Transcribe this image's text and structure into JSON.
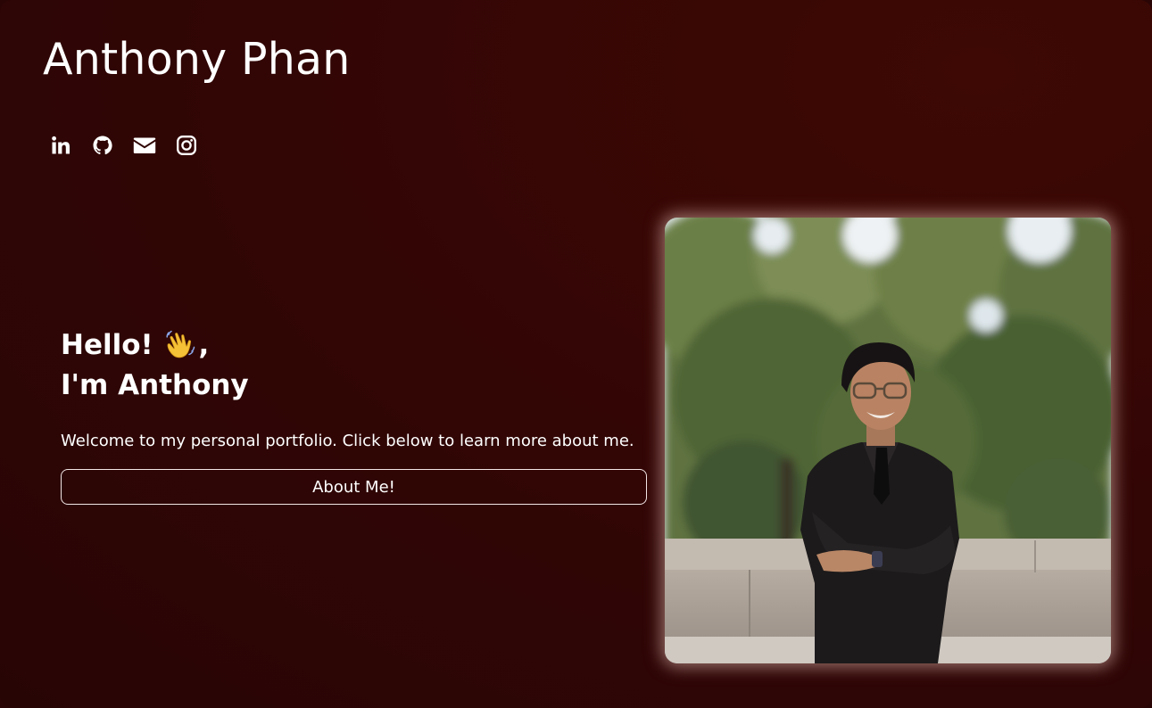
{
  "header": {
    "title": "Anthony Phan"
  },
  "socials": [
    {
      "name": "linkedin",
      "icon": "linkedin-icon"
    },
    {
      "name": "github",
      "icon": "github-icon"
    },
    {
      "name": "email",
      "icon": "envelope-icon"
    },
    {
      "name": "instagram",
      "icon": "instagram-icon"
    }
  ],
  "hero": {
    "greeting_line1": "Hello!",
    "wave_emoji": "👋",
    "greeting_comma": ",",
    "greeting_line2": "I'm Anthony",
    "welcome_text": "Welcome to my personal portfolio. Click below to learn more about me.",
    "about_button_label": "About Me!"
  },
  "profile_photo": {
    "icon": "profile-photo"
  },
  "colors": {
    "background": "#330605",
    "text": "#ffffff",
    "button_border": "#f2e6e6",
    "photo_glow": "#ffd7cd"
  }
}
